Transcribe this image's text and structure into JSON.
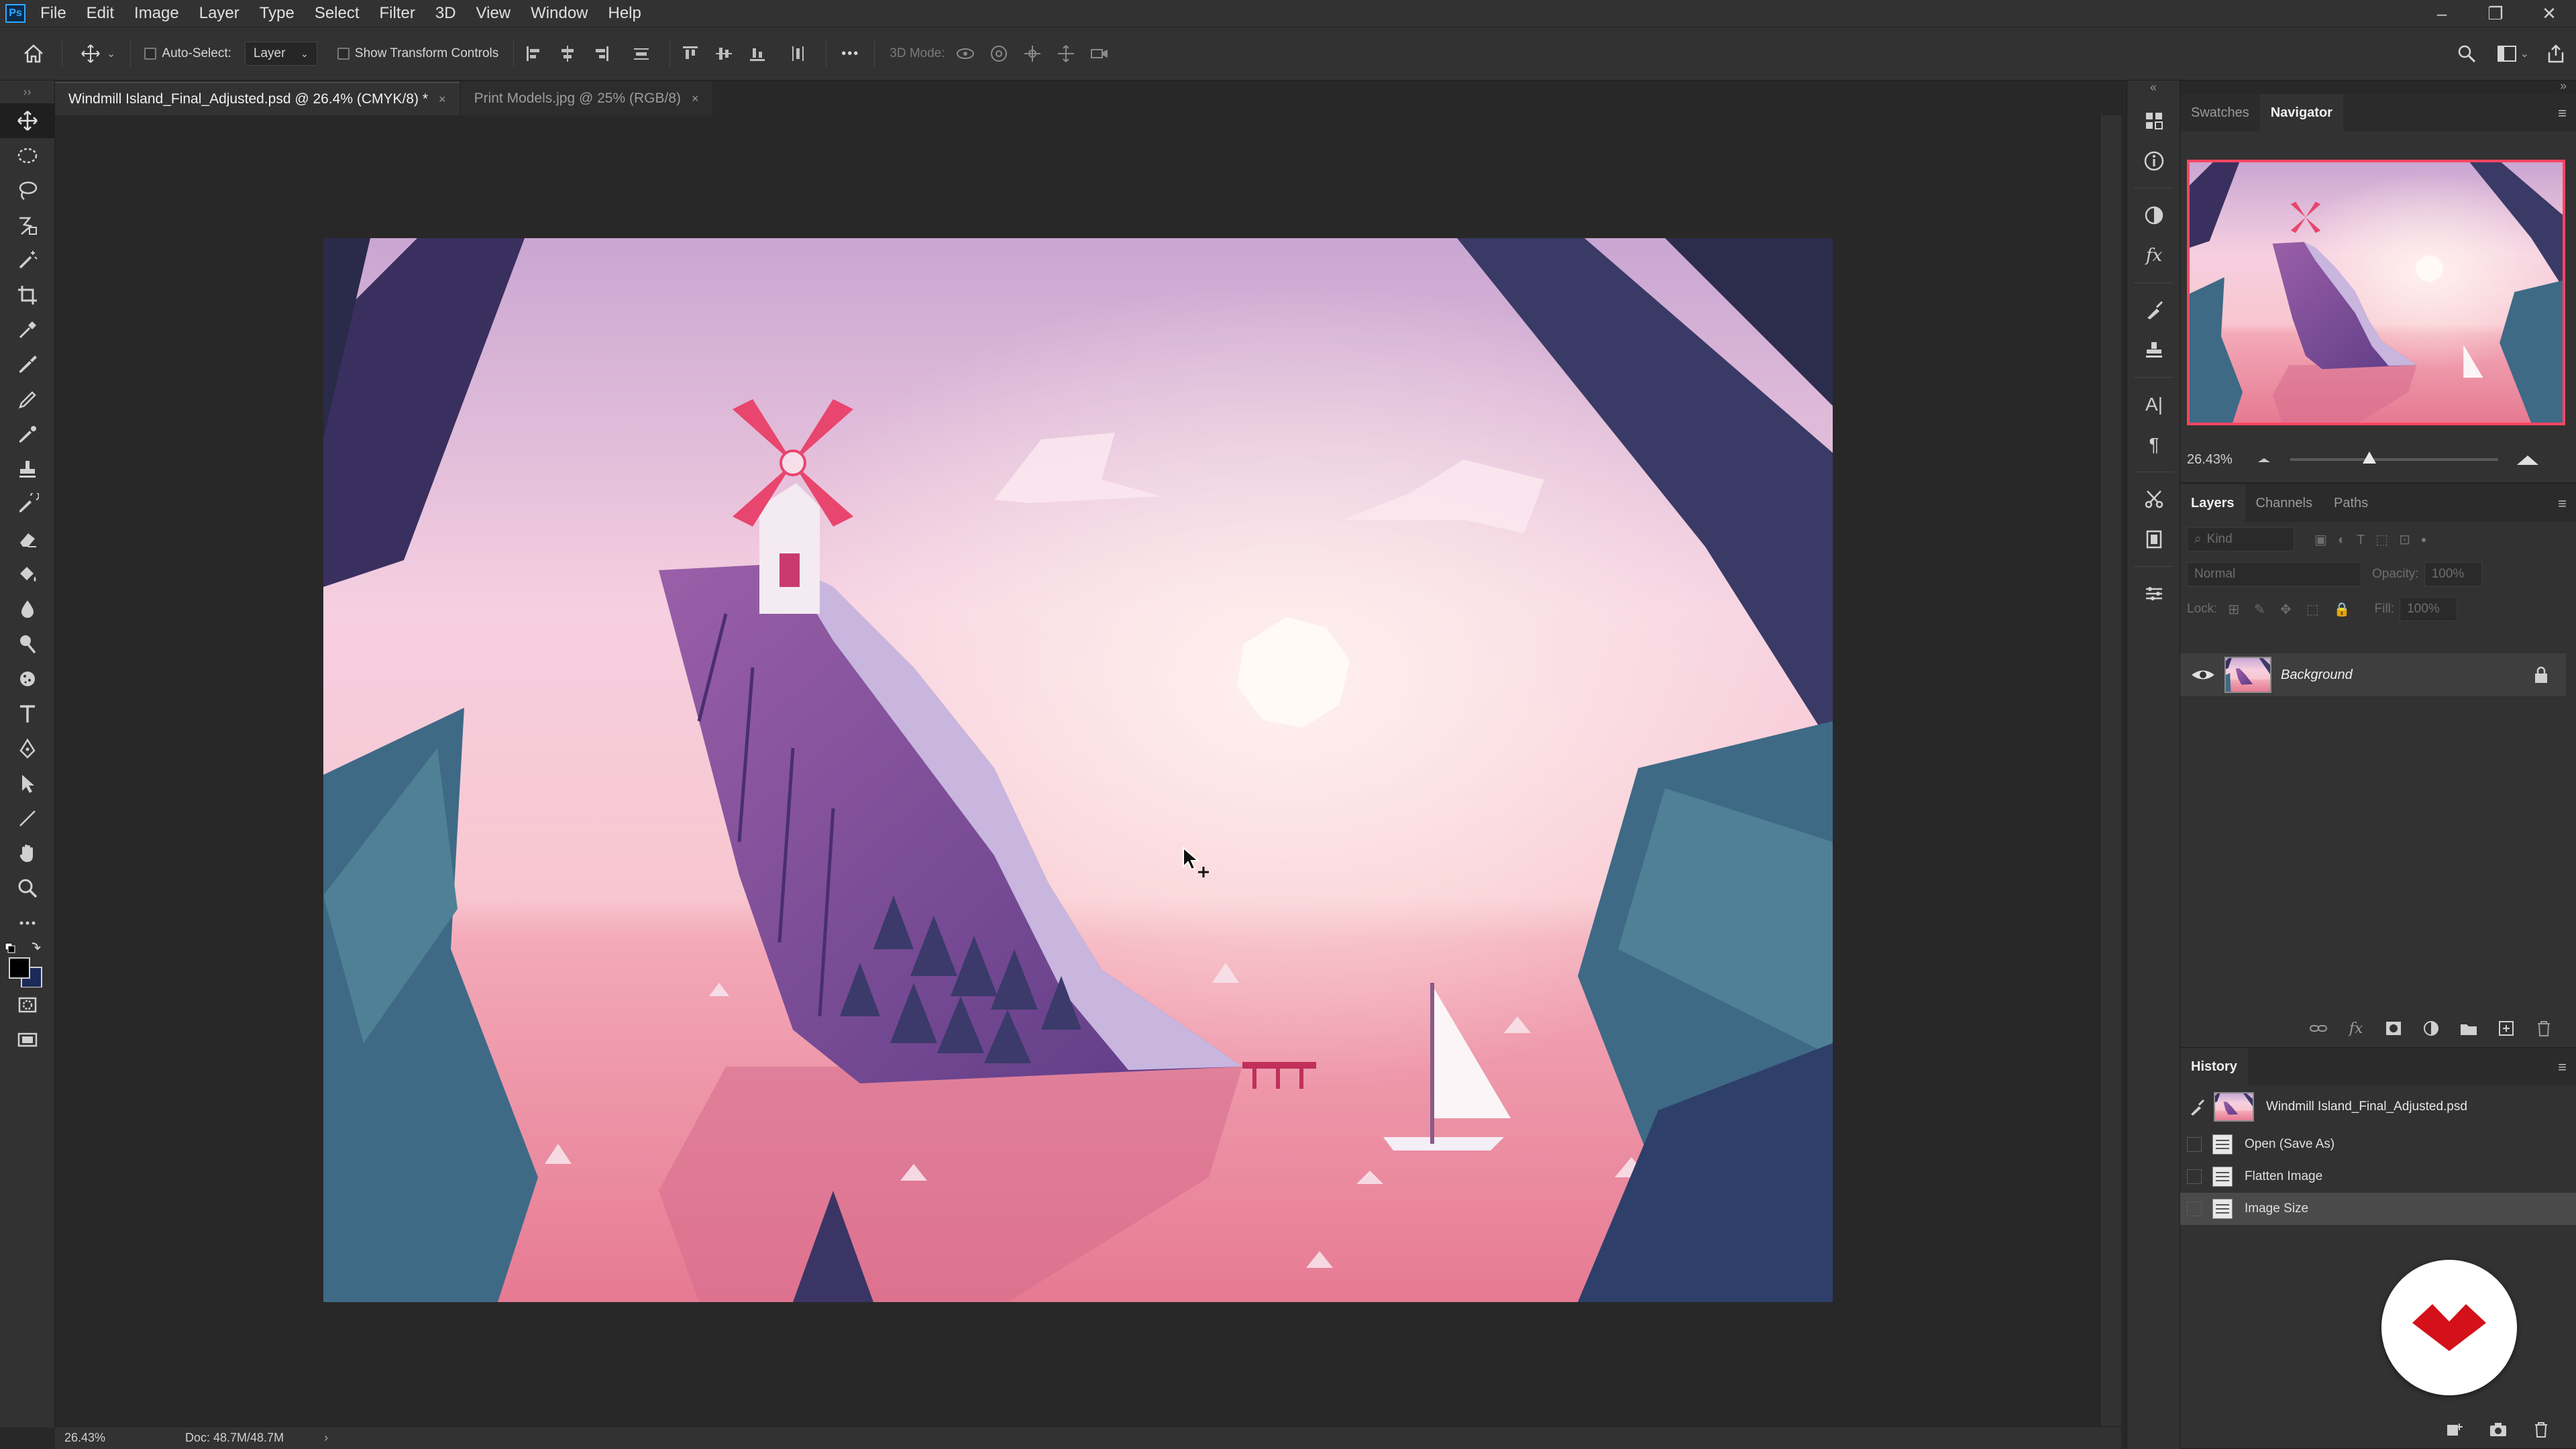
{
  "app": {
    "logo_text": "Ps",
    "menus": [
      "File",
      "Edit",
      "Image",
      "Layer",
      "Type",
      "Select",
      "Filter",
      "3D",
      "View",
      "Window",
      "Help"
    ]
  },
  "window_controls": {
    "minimize": "–",
    "restore": "❐",
    "close": "✕"
  },
  "options_bar": {
    "auto_select_label": "Auto-Select:",
    "auto_select_target": "Layer",
    "show_transform_label": "Show Transform Controls",
    "three_d_mode_label": "3D Mode:",
    "more_glyph": "•••"
  },
  "tabs": [
    {
      "label": "Windmill Island_Final_Adjusted.psd @ 26.4% (CMYK/8) *",
      "close": "×",
      "active": true
    },
    {
      "label": "Print Models.jpg @ 25% (RGB/8)",
      "close": "×",
      "active": false
    }
  ],
  "toolbar": {
    "grip": "››",
    "tools": [
      "move",
      "marquee",
      "lasso",
      "object-select",
      "magic-wand",
      "crop",
      "eyedropper",
      "healing-brush",
      "brush",
      "clone-stamp",
      "history-brush",
      "eraser",
      "paint-bucket",
      "blur",
      "dodge",
      "sponge",
      "type",
      "pen",
      "path-selection",
      "line",
      "hand",
      "zoom",
      "more"
    ]
  },
  "status_bar": {
    "zoom": "26.43%",
    "doc": "Doc: 48.7M/48.7M",
    "arrow": "›"
  },
  "navigator_panel": {
    "tabs": [
      "Swatches",
      "Navigator"
    ],
    "active_tab": "Navigator",
    "zoom_value": "26.43%",
    "zoom_slider_fraction": 0.38,
    "menu_glyph": "≡"
  },
  "layers_panel": {
    "tabs": [
      "Layers",
      "Channels",
      "Paths"
    ],
    "active_tab": "Layers",
    "filter_placeholder": "Kind",
    "blend_mode": "Normal",
    "opacity_label": "Opacity:",
    "opacity_value": "100%",
    "lock_label": "Lock:",
    "fill_label": "Fill:",
    "fill_value": "100%",
    "layers": [
      {
        "name": "Background",
        "visible": true,
        "locked": true
      }
    ],
    "menu_glyph": "≡"
  },
  "history_panel": {
    "title": "History",
    "snapshot_name": "Windmill Island_Final_Adjusted.psd",
    "steps": [
      "Open (Save As)",
      "Flatten Image",
      "Image Size"
    ],
    "selected_step": "Image Size",
    "menu_glyph": "≡"
  },
  "colors": {
    "accent": "#31a8ff",
    "navigator_box": "#ff4560",
    "brand_logo": "#d4101a",
    "panel_bg": "#323232",
    "canvas_bg": "#282828"
  }
}
